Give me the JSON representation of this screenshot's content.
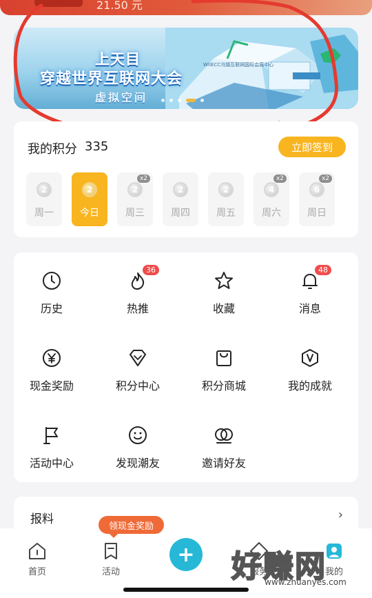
{
  "top_strip": {
    "amount_text": "21.50 元"
  },
  "banner": {
    "title_line1": "上天目",
    "title_line2": "穿越世界互联网大会",
    "title_line3": "虚拟空间",
    "watermark_text": "WIIECC乌镇互联网国际会展中心",
    "dot_count": 5,
    "active_dot": 3
  },
  "points": {
    "label": "我的积分",
    "value": "335",
    "checkin_label": "立即签到",
    "days": [
      {
        "label": "周一",
        "coin": "2",
        "today": false,
        "x2": false
      },
      {
        "label": "今日",
        "coin": "2",
        "today": true,
        "x2": false
      },
      {
        "label": "周三",
        "coin": "2",
        "today": false,
        "x2": true,
        "x2_text": "x2"
      },
      {
        "label": "周四",
        "coin": "2",
        "today": false,
        "x2": false
      },
      {
        "label": "周五",
        "coin": "2",
        "today": false,
        "x2": false
      },
      {
        "label": "周六",
        "coin": "4",
        "today": false,
        "x2": true,
        "x2_text": "x2"
      },
      {
        "label": "周日",
        "coin": "6",
        "today": false,
        "x2": true,
        "x2_text": "x2"
      }
    ]
  },
  "grid": {
    "items": [
      {
        "label": "历史",
        "icon": "clock-icon"
      },
      {
        "label": "热推",
        "icon": "fire-icon",
        "badge": "36"
      },
      {
        "label": "收藏",
        "icon": "star-icon"
      },
      {
        "label": "消息",
        "icon": "bell-icon",
        "badge": "48"
      },
      {
        "label": "现金奖励",
        "icon": "yen-coin-icon"
      },
      {
        "label": "积分中心",
        "icon": "diamond-icon"
      },
      {
        "label": "积分商城",
        "icon": "shopping-bag-icon"
      },
      {
        "label": "我的成就",
        "icon": "v-shield-icon"
      },
      {
        "label": "活动中心",
        "icon": "flag-icon"
      },
      {
        "label": "发现潮友",
        "icon": "smile-icon"
      },
      {
        "label": "邀请好友",
        "icon": "two-circles-icon"
      }
    ]
  },
  "report": {
    "label": "报料",
    "chevron": "›"
  },
  "promo_bubble": "领现金奖励",
  "bottom_nav": {
    "items": [
      {
        "label": "首页",
        "icon": "home-icon"
      },
      {
        "label": "活动",
        "icon": "bookmark-icon"
      },
      {
        "label": "服务",
        "icon": "service-icon"
      },
      {
        "label": "我的",
        "icon": "profile-icon"
      }
    ],
    "plus": "+"
  },
  "watermark": {
    "big": "好赚网",
    "small": "www.zhuanyes.com"
  },
  "colors": {
    "accent": "#f8b520",
    "plus": "#27b8d8",
    "badge": "#f04c4c",
    "annotation": "#e53a2e"
  }
}
